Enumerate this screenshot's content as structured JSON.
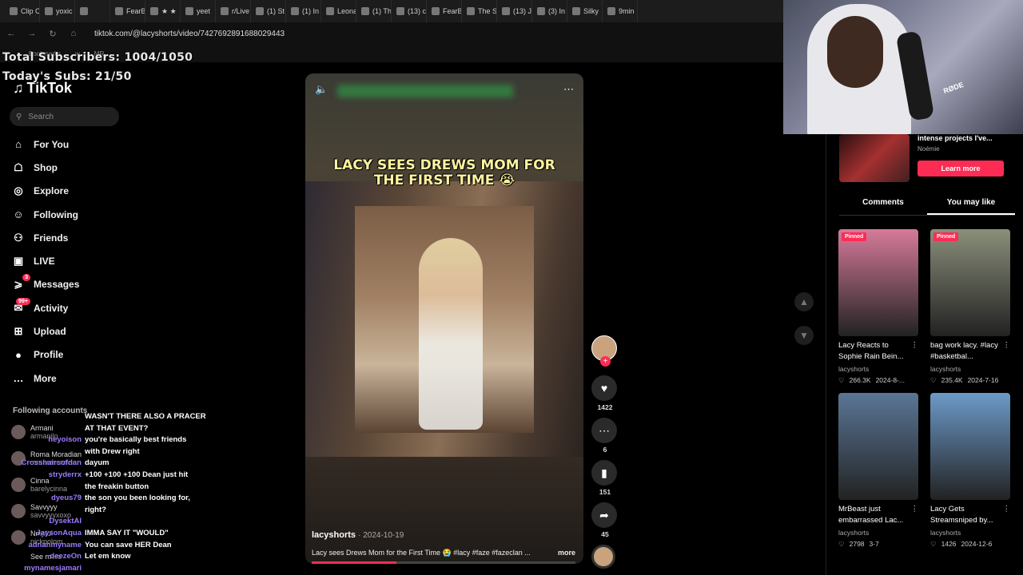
{
  "browser": {
    "tabs": [
      "Clip C",
      "yoxic",
      "",
      "FearB",
      "★ ★",
      "yeet",
      "r/Live",
      "(1) St",
      "(1) In",
      "Leona",
      "(1) Th",
      "(13) c",
      "FearB",
      "The S",
      "(13) J",
      "(3) In",
      "Silky",
      "9min"
    ],
    "url": "tiktok.com/@lacyshorts/video/7427692891688029443",
    "bookmarks": [
      "Bookmarks",
      "w",
      "MR"
    ]
  },
  "overlay": {
    "total_subs": "Total Subscribers: 1004/1050",
    "today_subs": "Today's Subs: 21/50"
  },
  "sidebar": {
    "logo": "TikTok",
    "search_placeholder": "Search",
    "items": [
      {
        "label": "For You",
        "icon": "home-icon"
      },
      {
        "label": "Shop",
        "icon": "shop-icon"
      },
      {
        "label": "Explore",
        "icon": "compass-icon"
      },
      {
        "label": "Following",
        "icon": "following-icon"
      },
      {
        "label": "Friends",
        "icon": "friends-icon"
      },
      {
        "label": "LIVE",
        "icon": "live-icon"
      },
      {
        "label": "Messages",
        "icon": "messages-icon",
        "badge": "3"
      },
      {
        "label": "Activity",
        "icon": "activity-icon",
        "badge": "99+"
      },
      {
        "label": "Upload",
        "icon": "upload-icon"
      },
      {
        "label": "Profile",
        "icon": "profile-icon"
      },
      {
        "label": "More",
        "icon": "more-icon"
      }
    ],
    "following_heading": "Following accounts",
    "accounts": [
      {
        "name": "Armani",
        "handle": "armanilo"
      },
      {
        "name": "Roma Moradian",
        "handle": "romamoradian"
      },
      {
        "name": "Cinna",
        "handle": "barelycinna"
      },
      {
        "name": "Savvyyy",
        "handle": "savvyyyxoxo"
      },
      {
        "name": "Nmplol",
        "handle": "nickpolom"
      }
    ],
    "see_more": "See more"
  },
  "chat": [
    {
      "user": "",
      "text": "WASN'T THERE ALSO A PRACER"
    },
    {
      "user": "",
      "text": "AT THAT EVENT?"
    },
    {
      "user": "heyoison",
      "text": "you're basically best friends"
    },
    {
      "user": "",
      "text": "with Drew right"
    },
    {
      "user": "Crosshairsofdan",
      "text": "dayum"
    },
    {
      "user": "stryderrx",
      "text": "+100 +100 +100 Dean just hit"
    },
    {
      "user": "",
      "text": "the freakin button"
    },
    {
      "user": "dyeus79",
      "text": "the son you been looking for,"
    },
    {
      "user": "",
      "text": "right?"
    },
    {
      "user": "DysektAI",
      "text": ""
    },
    {
      "user": "JaysonAqua",
      "text": "IMMA SAY IT \"WOULD\""
    },
    {
      "user": "adnanmyname",
      "text": "You can save HER Dean"
    },
    {
      "user": "deezeOn",
      "text": "Let em know"
    },
    {
      "user": "mynamesjamari",
      "text": ""
    }
  ],
  "video": {
    "caption_line1": "LACY SEES DREWS MOM FOR",
    "caption_line2": "THE FIRST TIME 😭",
    "author": "lacyshorts",
    "date": "· 2024-10-19",
    "description": "Lacy sees Drews Mom for the First Time 😭 #lacy #faze #fazeclan ...",
    "more_label": "more",
    "progress": 0.32
  },
  "actions": {
    "likes": "1422",
    "comments": "6",
    "saves": "151",
    "shares": "45"
  },
  "webcam": {
    "mic_text": "RØDE"
  },
  "ad": {
    "title": "intense projects I've...",
    "author": "Noémie",
    "button": "Learn more"
  },
  "right_tabs": [
    "Comments",
    "You may like"
  ],
  "recommended": [
    {
      "pinned": "Pinned",
      "title": "Lacy Reacts to Sophie Rain Bein...",
      "author": "lacyshorts",
      "likes": "266.3K",
      "date": "2024-8-...",
      "color": "#d67a9a"
    },
    {
      "pinned": "Pinned",
      "title": "bag work lacy. #lacy #basketbal...",
      "author": "lacyshorts",
      "likes": "235.4K",
      "date": "2024-7-16",
      "color": "#8a8f7a"
    },
    {
      "pinned": "",
      "title": "MrBeast just embarrassed Lac...",
      "author": "lacyshorts",
      "likes": "2798",
      "date": "3-7",
      "color": "#5a7696"
    },
    {
      "pinned": "",
      "title": "Lacy Gets Streamsniped by...",
      "author": "lacyshorts",
      "likes": "1426",
      "date": "2024-12-6",
      "color": "#6c9ac8"
    }
  ]
}
